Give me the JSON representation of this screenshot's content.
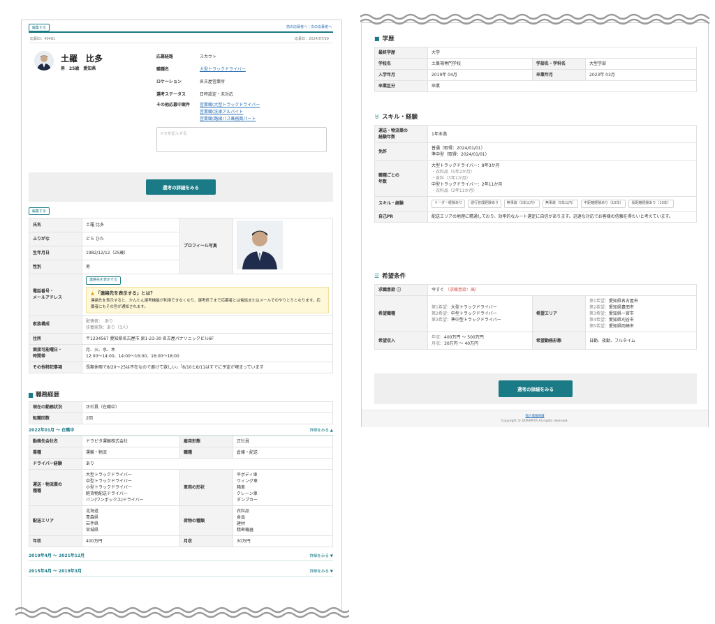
{
  "left": {
    "edit_label": "編集する",
    "nav": {
      "prev": "前の応募者へ",
      "separator": "|",
      "next": "次の応募者へ"
    },
    "id_text": "応募ID：40481",
    "applied_date": "応募日：2024/07/29",
    "profile": {
      "name": "土羅　比多",
      "meta": "男　25歳　愛知県"
    },
    "summary": [
      {
        "label": "応募経路",
        "value": "スカウト"
      },
      {
        "label": "職種名",
        "value": "大型トラックドライバー"
      },
      {
        "label": "ロケーション",
        "value": "名古屋営業所"
      },
      {
        "label": "選考ステータス",
        "value": "日時設定・未対応"
      }
    ],
    "other_label": "その他応募中案件",
    "other_links": [
      "営業職(大型トラックドライバー",
      "営業職(洗車アルバイト",
      "営業職(路線バス乗務員パート"
    ],
    "memo_placeholder": "メモを記入する",
    "cta_label": "選考の詳細をみる",
    "basic_edit": "編集する",
    "basic": {
      "name_label": "氏名",
      "name": "土羅 比多",
      "kana_label": "ふりがな",
      "kana": "どら ひた",
      "photo_label": "プロフィール写真",
      "birth_label": "生年月日",
      "birth": "1982/12/12（25歳）",
      "gender_label": "性別",
      "gender": "男",
      "contact_label": "電話番号・\nメールアドレス",
      "contact_btn": "連絡先を表示する",
      "warn_title": "「連絡先を表示する」とは？",
      "warn_text": "連絡先を表示すると、かんたん選考機能が利用できなくなり、選考終了まで応募者とは電話またはメールでのやりとりとなります。応募者にもその旨が通知されます。",
      "family_label": "家族構成",
      "family": [
        "配偶者：　あり",
        "扶養家族：あり（3人）"
      ],
      "address_label": "住所",
      "address": "〒1234567 愛知県名古屋市 泉1-23-30 名古屋パナソニックビル6F",
      "interview_label": "面接可能曜日・\n時間帯",
      "interview": [
        "月、火、水、木",
        "12:00〜14:00、14:00〜16:00、16:00〜18:00"
      ],
      "notes_label": "その他特記事項",
      "notes": "長期休暇で8/20〜25は不在なので避けて欲しい」「8/10と8/11はすでに予定が埋まっています"
    },
    "career_title": "職務経歴",
    "career_summary": [
      {
        "label": "現在の勤務状況",
        "value": "正社員（在職中）"
      },
      {
        "label": "転職回数",
        "value": "2回"
      }
    ],
    "career_period_1": "2022年01月 〜 在職中",
    "career_more_open": "詳細をみる ▲",
    "career_detail": {
      "company_label": "勤務先会社名",
      "company": "ドラピタ運輸株式会社",
      "employ_label": "雇用形態",
      "employ": "正社員",
      "industry_label": "業種",
      "industry": "運輸・物流",
      "job_label": "職種",
      "job": "倉庫・配送",
      "driver_label": "ドライバー経験",
      "driver": "あり",
      "kind_label": "運送・物流業の\n種種",
      "kinds": [
        "大型トラックドライバー",
        "中型トラックドライバー",
        "小型トラックドライバー",
        "軽貨物配送ドライバー",
        "バン(ワンボックス)ドライバー"
      ],
      "vehicle_label": "車両の形状",
      "vehicles": [
        "平ボディ車",
        "ウィング車",
        "箱車",
        "クレーン車",
        "ダンプカー"
      ],
      "area_label": "配送エリア",
      "areas": [
        "北海道",
        "青森県",
        "岩手県",
        "宮城県"
      ],
      "goods_label": "荷物の種類",
      "goods": [
        "衣料品",
        "食品",
        "建材",
        "精密機器"
      ],
      "salary_label": "年収",
      "salary": "400万円",
      "monthly_label": "月収",
      "monthly": "30万円"
    },
    "career_period_2": "2019年4月 〜 2021年12月",
    "career_period_3": "2015年4月 〜 2019年3月",
    "career_more": "詳細をみる ▼"
  },
  "right": {
    "edu_title": "学歴",
    "edu": {
      "final_label": "最終学歴",
      "final": "大学",
      "school_label": "学校名",
      "school": "土巣場専門学校",
      "dept_label": "学部名・学科名",
      "dept": "大型学部",
      "enter_label": "入学年月",
      "enter": "2019年 04月",
      "grad_label": "卒業年月",
      "grad": "2023年 03月",
      "type_label": "卒業区分",
      "type": "卒業"
    },
    "skill_title": "スキル・経験",
    "skill": {
      "years_label": "運送・物流業の\n経験年数",
      "years": "1年未満",
      "license_label": "免許",
      "licenses": [
        "普通（取得：2024/01/01）",
        "準中型（取得：2024/01/01）"
      ],
      "jobyears_label": "職種ごとの\n年数",
      "jobyears": [
        {
          "text": "大型トラックドライバー：8年3か月",
          "grey": false
        },
        {
          "text": "・衣料品（5年2か月）",
          "grey": true
        },
        {
          "text": "・食料（3年1か月）",
          "grey": true
        },
        {
          "text": "中型トラックドライバー：2年11か月",
          "grey": false
        },
        {
          "text": "・衣料品（2年11か月）",
          "grey": true
        }
      ],
      "skills_label": "スキル・経験",
      "tags": [
        "リーダー経験あり",
        "運行管理経験あり",
        "無事故（5年以内）",
        "無事故（5年以内）",
        "中距離経験あり（10年）",
        "長距離経験あり（10年）"
      ],
      "pr_label": "自己PR",
      "pr": "配送エリアの地理に精通しており、効率的なルート選定に自信があります。迅速な対応でお客様の信頼を得たいと考えています。"
    },
    "wish_title": "希望条件",
    "wish": {
      "motivation_label": "求職意欲 ⓘ",
      "motivation": "今すぐ",
      "motivation_level": "（求職意欲：高）",
      "job_label": "希望職種",
      "jobs": [
        {
          "k": "第1希望：",
          "v": "大型トラックドライバー"
        },
        {
          "k": "第2希望：",
          "v": "中型トラックドライバー"
        },
        {
          "k": "第3希望：",
          "v": "準中型トラックドライバー"
        }
      ],
      "area_label": "希望エリア",
      "areas": [
        {
          "k": "第1希望：",
          "v": "愛知県名古屋市"
        },
        {
          "k": "第2希望：",
          "v": "愛知県豊田市"
        },
        {
          "k": "第3希望：",
          "v": "愛知県一宮市"
        },
        {
          "k": "第4希望：",
          "v": "愛知県刈谷市"
        },
        {
          "k": "第5希望：",
          "v": "愛知県岡崎市"
        }
      ],
      "income_label": "希望収入",
      "income": [
        {
          "k": "年収：",
          "v": "400万円 〜 500万円"
        },
        {
          "k": "月収：",
          "v": "30万円 〜 40万円"
        }
      ],
      "shift_label": "希望勤務形態",
      "shift": "日勤、夜勤、フルタイム"
    },
    "cta_label": "選考の詳細をみる",
    "footer_link": "個人情報保護",
    "copyright": "Copyright © DORAPITA All rights reserved."
  }
}
